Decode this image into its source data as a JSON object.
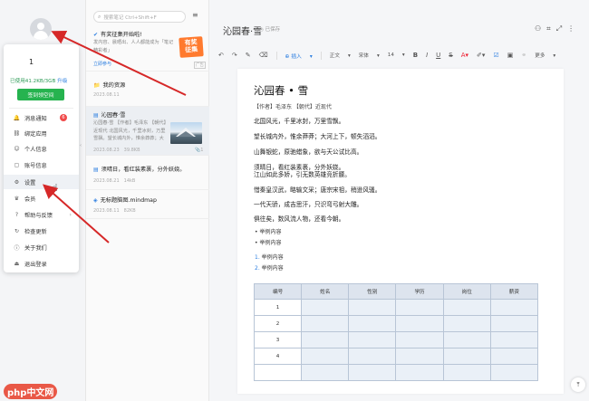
{
  "user": {
    "name": "1",
    "storage_text": "已使用41.2KB/3GB ",
    "upgrade_link": "升级",
    "upgrade_button": "签到领空间"
  },
  "menu": [
    {
      "label": "消息通知",
      "icon": "bell-icon",
      "glyph": "🔔",
      "badge": "6"
    },
    {
      "label": "绑定应用",
      "icon": "link-icon",
      "glyph": "⛓"
    },
    {
      "label": "个人信息",
      "icon": "user-icon",
      "glyph": "☺"
    },
    {
      "label": "账号信息",
      "icon": "account-icon",
      "glyph": "▢"
    },
    {
      "label": "设置",
      "icon": "gear-icon",
      "glyph": "⚙"
    },
    {
      "label": "会员",
      "icon": "crown-icon",
      "glyph": "♛"
    },
    {
      "label": "帮助与反馈",
      "icon": "help-icon",
      "glyph": "?",
      "arrow": "›"
    },
    {
      "label": "检查更新",
      "icon": "refresh-icon",
      "glyph": "↻"
    },
    {
      "label": "关于我们",
      "icon": "info-icon",
      "glyph": "ⓘ"
    },
    {
      "label": "退出登录",
      "icon": "logout-icon",
      "glyph": "⏏"
    }
  ],
  "search": {
    "placeholder": "搜索笔记 Ctrl+Shift+F"
  },
  "promo": {
    "title": "有奖征集开始啦!",
    "desc1": "发内容、晨晒出、人人都能成为「笔记",
    "desc2": "精彩者」",
    "badge1": "有奖",
    "badge2": "征集",
    "join": "立即参与",
    "ad": "广告"
  },
  "notes": [
    {
      "title": "我的资源",
      "date": "2023.08.11",
      "icon": "folder-icon",
      "glyph": "📁"
    },
    {
      "title": "沁园春·雪",
      "preview": "沁园春·雪 【作者】毛泽东 【朝代】近现代 北国风光，千里冰封，万里雪飘。望长城内外，惟余莽莽；大河上下，顿失滔滔。",
      "date": "2023.08.23",
      "size": "39.8KB",
      "attachments": "1",
      "icon": "doc-icon",
      "glyph": "▤"
    },
    {
      "title": "须晴日，看红装素裹，分外妖娆。",
      "date": "2023.08.21",
      "size": "14kB",
      "icon": "doc-icon",
      "glyph": "▤"
    },
    {
      "title": "无标题脑图.mindmap",
      "date": "2023.08.11",
      "size": "82KB",
      "icon": "mindmap-icon",
      "glyph": "◈"
    }
  ],
  "editor": {
    "title": "沁园春·雪",
    "saved": "已保存"
  },
  "toolbar": {
    "insert": "插入",
    "style": "正文",
    "font": "宋体",
    "size": "14",
    "more": "更多"
  },
  "doc": {
    "title": "沁园春 • 雪",
    "meta": "【作者】毛泽东 【朝代】近现代",
    "lines": [
      "北国风光，千里冰封，万里雪飘。",
      "望长城内外，惟余莽莽；大河上下，顿失滔滔。",
      "山舞银蛇，原驰蜡象，欲与天公试比高。",
      "须晴日，看红装素裹，分外妖娆。",
      "江山如此多娇，引无数英雄竞折腰。",
      "惜秦皇汉武，略输文采；唐宗宋祖，稍逊风骚。",
      "一代天骄，成吉思汗，只识弯弓射大雕。",
      "俱往矣，数风流人物，还看今朝。"
    ],
    "bullets": [
      "举例内容",
      "举例内容"
    ],
    "numbered": [
      {
        "n": "1.",
        "t": "举例内容"
      },
      {
        "n": "2.",
        "t": "举例内容"
      }
    ],
    "table_headers": [
      "编号",
      "姓名",
      "性别",
      "学历",
      "岗位",
      "薪资"
    ],
    "table_rows": [
      "1",
      "2",
      "3",
      "4",
      ""
    ]
  },
  "watermark": {
    "p": "php",
    "cn": "中文网"
  }
}
